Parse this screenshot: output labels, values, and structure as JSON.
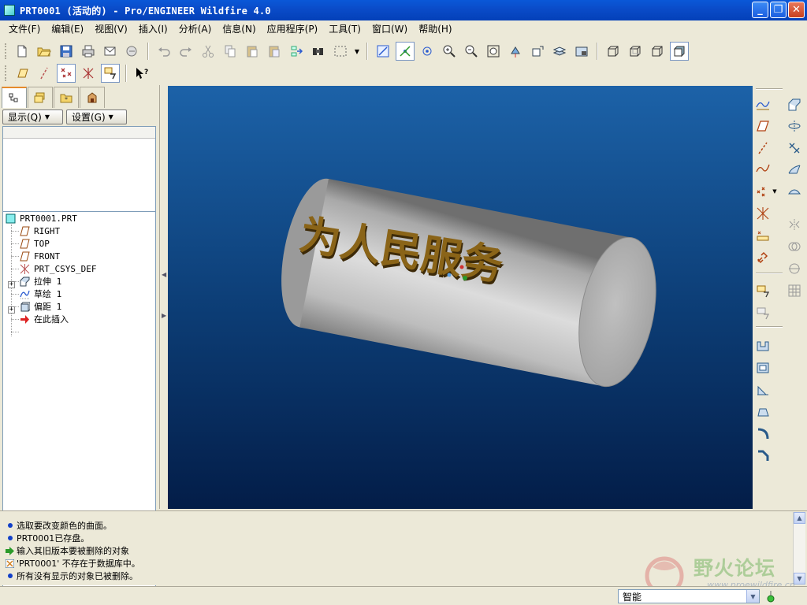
{
  "window": {
    "title": "PRT0001 (活动的) - Pro/ENGINEER Wildfire 4.0",
    "minimize": "_",
    "maximize": "❐",
    "close": "✕"
  },
  "menu": [
    {
      "id": "file",
      "label": "文件(F)"
    },
    {
      "id": "edit",
      "label": "编辑(E)"
    },
    {
      "id": "view",
      "label": "视图(V)"
    },
    {
      "id": "insert",
      "label": "插入(I)"
    },
    {
      "id": "analysis",
      "label": "分析(A)"
    },
    {
      "id": "info",
      "label": "信息(N)"
    },
    {
      "id": "applications",
      "label": "应用程序(P)"
    },
    {
      "id": "tools",
      "label": "工具(T)"
    },
    {
      "id": "window",
      "label": "窗口(W)"
    },
    {
      "id": "help",
      "label": "帮助(H)"
    }
  ],
  "left_panel": {
    "show_button": "显示(Q)",
    "settings_button": "设置(G)",
    "tree": [
      {
        "label": "PRT0001.PRT",
        "icon": "part-icon"
      },
      {
        "label": "RIGHT",
        "icon": "datum-plane-icon"
      },
      {
        "label": "TOP",
        "icon": "datum-plane-icon"
      },
      {
        "label": "FRONT",
        "icon": "datum-plane-icon"
      },
      {
        "label": "PRT_CSYS_DEF",
        "icon": "csys-icon"
      },
      {
        "label": "拉伸 1",
        "icon": "extrude-icon"
      },
      {
        "label": "草绘 1",
        "icon": "sketch-icon"
      },
      {
        "label": "偏距 1",
        "icon": "offset-icon"
      },
      {
        "label": "在此插入",
        "icon": "insert-here-arrow-icon"
      }
    ]
  },
  "model": {
    "embossed_text": "为人民服务",
    "colors": {
      "text_face": "#8a6418",
      "cylinder_body": "#c8c8c8"
    }
  },
  "messages": [
    {
      "icon": "info-dot",
      "text": "选取要改变颜色的曲面。"
    },
    {
      "icon": "info-dot",
      "text": "PRT0001已存盘。"
    },
    {
      "icon": "prompt-arrow",
      "text": "输入其旧版本要被删除的对象"
    },
    {
      "icon": "warning-icon",
      "text": "'PRT0001' 不存在于数据库中。"
    },
    {
      "icon": "info-dot",
      "text": "所有没有显示的对象已被删除。"
    }
  ],
  "status": {
    "selection_filter": "智能"
  },
  "watermark": {
    "text": "野火论坛",
    "url": "www.proewildfire.cn"
  },
  "colors": {
    "titlebar": "#0a52d0",
    "viewport_top": "#1c62a8",
    "viewport_bottom": "#031d48",
    "chrome": "#ece9d8"
  }
}
